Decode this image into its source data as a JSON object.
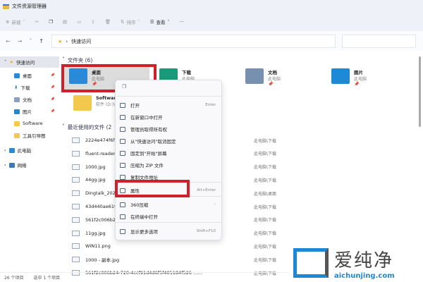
{
  "window": {
    "title": "文件资源管理器"
  },
  "toolbar": {
    "new": "新建",
    "sort": "排序",
    "view": "查看",
    "more": "···"
  },
  "address": {
    "path": "快速访问"
  },
  "sidebar": {
    "items": [
      {
        "label": "快速访问",
        "pinned": false
      },
      {
        "label": "桌面",
        "pinned": true
      },
      {
        "label": "下载",
        "pinned": true
      },
      {
        "label": "文档",
        "pinned": true
      },
      {
        "label": "图片",
        "pinned": true
      },
      {
        "label": "Software",
        "pinned": false
      },
      {
        "label": "工具引导图",
        "pinned": false
      },
      {
        "label": "此电脑",
        "pinned": false
      },
      {
        "label": "网络",
        "pinned": false
      }
    ]
  },
  "folders": {
    "header": "文件夹 (6)",
    "items": [
      {
        "name": "桌面",
        "sub": "此电脑",
        "color": "#2a8ad8"
      },
      {
        "name": "下载",
        "sub": "此电脑",
        "color": "#1a9a7a"
      },
      {
        "name": "文档",
        "sub": "此电脑",
        "color": "#7890b0"
      },
      {
        "name": "图片",
        "sub": "此电脑",
        "color": "#1e8ad6"
      },
      {
        "name": "Software",
        "sub": "软件 (D:)\\...",
        "color": "#f2c94c"
      }
    ]
  },
  "recent": {
    "header": "最近使用的文件 (2",
    "files": [
      {
        "name": "2224e474f6fe",
        "loc": "此电脑\\下载"
      },
      {
        "name": "fluent-reader_",
        "loc": "此电脑\\下载"
      },
      {
        "name": "1000.jpg",
        "loc": "此电脑\\下载"
      },
      {
        "name": "44gg.jpg",
        "loc": "此电脑\\下载"
      },
      {
        "name": "Dingtalk_202",
        "loc": "此电脑\\桌面"
      },
      {
        "name": "43d440ae619",
        "loc": "此电脑\\下载"
      },
      {
        "name": "561f2c006b24",
        "loc": "此电脑\\下载"
      },
      {
        "name": "11gg.jpg",
        "loc": "此电脑\\下载"
      },
      {
        "name": "WIN11.png",
        "loc": "此电脑\\下载"
      },
      {
        "name": "1000 - 副本.jpg",
        "loc": "此电脑\\下载"
      },
      {
        "name": "561f2c006b24-720-4ccf91d4d6f5f405184f526 ……",
        "loc": "此电脑\\下载"
      }
    ]
  },
  "context_menu": {
    "items": [
      {
        "label": "打开",
        "shortcut": "Enter"
      },
      {
        "label": "在新窗口中打开",
        "shortcut": ""
      },
      {
        "label": "管理员取得所有权",
        "shortcut": ""
      },
      {
        "label": "从\"快速访问\"取消固定",
        "shortcut": ""
      },
      {
        "label": "固定到\"开始\"屏幕",
        "shortcut": ""
      },
      {
        "label": "压缩为 ZIP 文件",
        "shortcut": ""
      },
      {
        "label": "复制文件地址",
        "shortcut": ""
      },
      {
        "label": "属性",
        "shortcut": "Alt+Enter"
      },
      {
        "label": "360压缩",
        "shortcut": "›"
      },
      {
        "label": "在终端中打开",
        "shortcut": ""
      },
      {
        "label": "显示更多选项",
        "shortcut": "Shift+F10"
      }
    ]
  },
  "status": {
    "count": "26 个项目",
    "selected": "选中 1 个项目"
  },
  "watermark": {
    "text": "爱纯净",
    "url": "aichunjing.com"
  }
}
